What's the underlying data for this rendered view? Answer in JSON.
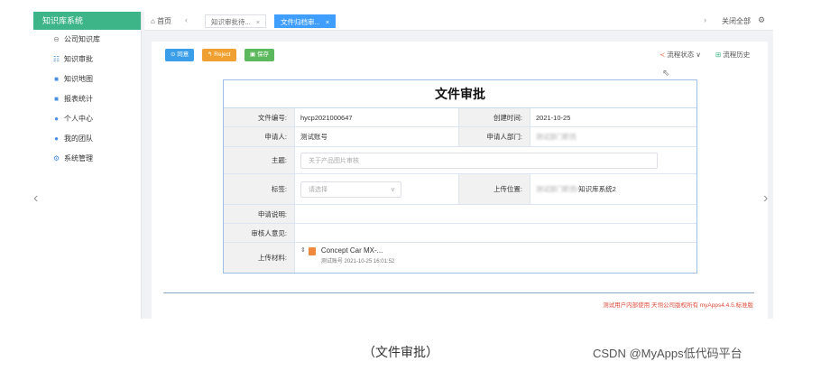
{
  "sidebar": {
    "title": "知识库系统",
    "items": [
      {
        "icon": "database-icon",
        "glyph": "⊖",
        "label": "公司知识库"
      },
      {
        "icon": "tree-icon",
        "glyph": "☷",
        "label": "知识审批"
      },
      {
        "icon": "map-icon",
        "glyph": "■",
        "label": "知识地图"
      },
      {
        "icon": "chart-icon",
        "glyph": "■",
        "label": "报表统计"
      },
      {
        "icon": "user-icon",
        "glyph": "●",
        "label": "个人中心"
      },
      {
        "icon": "team-icon",
        "glyph": "●",
        "label": "我的团队"
      },
      {
        "icon": "settings-icon",
        "glyph": "⚙",
        "label": "系统管理"
      }
    ]
  },
  "tabs": {
    "home": "首页",
    "items": [
      {
        "label": "知识审批待...",
        "active": false
      },
      {
        "label": "文件归档审...",
        "active": true
      }
    ],
    "close_all": "关闭全部"
  },
  "toolbar": {
    "agree": "同意",
    "reject": "Reject",
    "save": "保存",
    "flow_state": "流程状态",
    "flow_history": "流程历史"
  },
  "form": {
    "title": "文件审批",
    "doc_no_label": "文件编号:",
    "doc_no": "hycp2021000647",
    "created_label": "创建时间:",
    "created": "2021-10-25",
    "applicant_label": "申请人:",
    "applicant": "测试账号",
    "dept_label": "申请人部门:",
    "dept": "测试部门职员",
    "subject_label": "主题:",
    "subject": "关于产品图片审核",
    "tags_label": "标签:",
    "tags_placeholder": "请选择",
    "location_label": "上传位置:",
    "location_blur": "测试部门职员/",
    "location": "知识库系统2",
    "desc_label": "申请说明:",
    "opinion_label": "审核人意见:",
    "material_label": "上传材料:",
    "file_name": "Concept Car MX-...",
    "file_meta": "测试账号  2021-10-25 16:01:52"
  },
  "footer_note": "测试用户内部使用 天翎公司版权所有 myApps4.4.5.标准版",
  "caption": "（文件审批）",
  "watermark": "CSDN @MyApps低代码平台"
}
